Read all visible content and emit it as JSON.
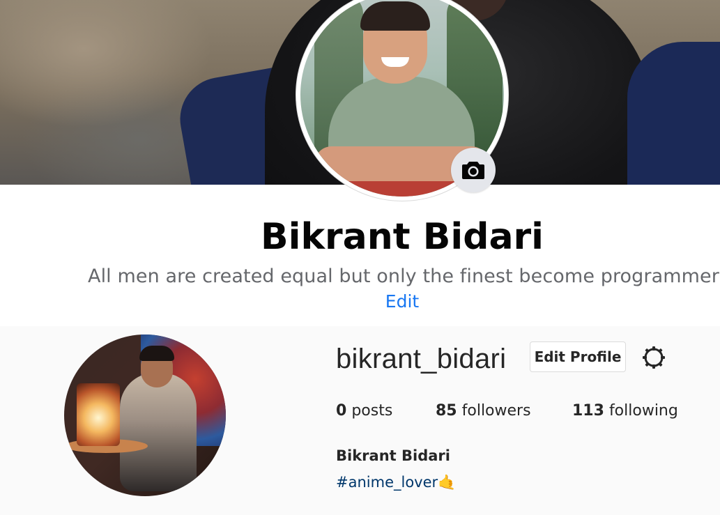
{
  "cover": {
    "camera_icon": "camera-icon"
  },
  "profile": {
    "name": "Bikrant Bidari",
    "bio": "All men are created equal but only the finest become programmer",
    "bio_emoji": "✌️",
    "edit_label": "Edit"
  },
  "account": {
    "username": "bikrant_bidari",
    "edit_profile_label": "Edit Profile",
    "settings_icon": "gear-icon",
    "stats": {
      "posts_count": "0",
      "posts_label": "posts",
      "followers_count": "85",
      "followers_label": "followers",
      "following_count": "113",
      "following_label": "following"
    },
    "full_name": "Bikrant Bidari",
    "hashtag": "#anime_lover",
    "hashtag_emoji": "🤙"
  },
  "colors": {
    "link_blue": "#1877f2",
    "hashtag_blue": "#00376b",
    "bio_gray": "#65676b",
    "lower_bg": "#fafafa"
  }
}
